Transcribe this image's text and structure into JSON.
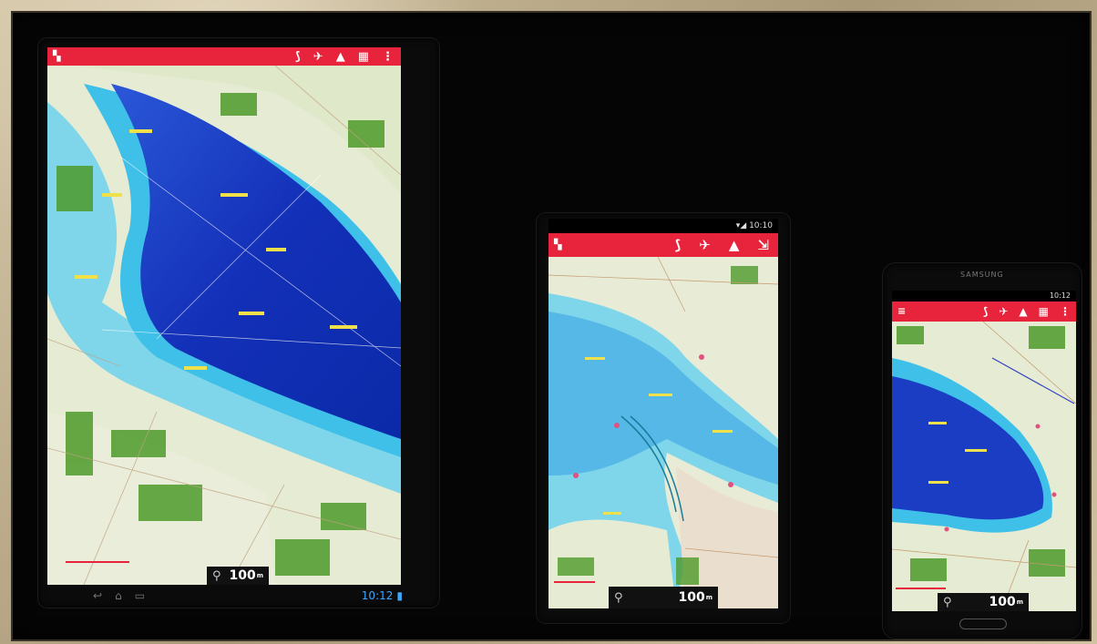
{
  "devices": {
    "tablet": {
      "app_icons": [
        "route-icon",
        "pin-icon",
        "road-icon",
        "layers-icon",
        "menu-dots-icon"
      ],
      "glyphs": [
        "⟆",
        "✈",
        "▲",
        "▦",
        "⋮"
      ],
      "zoom_value": "100",
      "zoom_unit": "m",
      "clock": "10:12"
    },
    "phone_mid": {
      "status_time": "10:10",
      "app_icons": [
        "route-icon",
        "pin-icon",
        "road-icon",
        "export-icon"
      ],
      "glyphs": [
        "⟆",
        "✈",
        "▲",
        "⇲"
      ],
      "zoom_value": "100",
      "zoom_unit": "m"
    },
    "phone_small": {
      "brand": "SAMSUNG",
      "status_time": "10:12",
      "app_icons": [
        "route-icon",
        "pin-icon",
        "road-icon",
        "layers-icon",
        "menu-dots-icon"
      ],
      "glyphs": [
        "⟆",
        "✈",
        "▲",
        "▦",
        "⋮"
      ],
      "zoom_value": "100",
      "zoom_unit": "m"
    }
  },
  "colors": {
    "accent": "#e8243c",
    "deep_water": "#1330b8",
    "shallow_water": "#3fc0e8",
    "land": "#e6ebd3",
    "forest": "#4e9a2a"
  }
}
